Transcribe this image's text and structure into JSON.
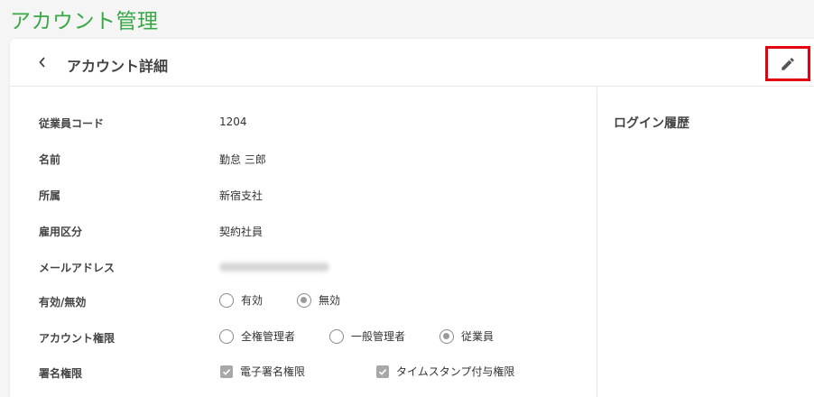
{
  "page_title": "アカウント管理",
  "card": {
    "title": "アカウント詳細",
    "back_icon": "chevron-left-icon",
    "edit_icon": "pencil-icon",
    "highlight_color": "#e3000f",
    "accent_color": "#3aa847"
  },
  "fields": {
    "employee_code": {
      "label": "従業員コード",
      "value": "1204"
    },
    "name": {
      "label": "名前",
      "value": "勤怠 三郎"
    },
    "affiliation": {
      "label": "所属",
      "value": "新宿支社"
    },
    "employment_type": {
      "label": "雇用区分",
      "value": "契約社員"
    },
    "email": {
      "label": "メールアドレス"
    },
    "active": {
      "label": "有効/無効",
      "options": [
        {
          "label": "有効",
          "selected": false
        },
        {
          "label": "無効",
          "selected": true
        }
      ]
    },
    "account_role": {
      "label": "アカウント権限",
      "options": [
        {
          "label": "全権管理者",
          "selected": false
        },
        {
          "label": "一般管理者",
          "selected": false
        },
        {
          "label": "従業員",
          "selected": true
        }
      ]
    },
    "signature_role": {
      "label": "署名権限",
      "options": [
        {
          "label": "電子署名権限",
          "checked": true
        },
        {
          "label": "タイムスタンプ付与権限",
          "checked": true
        }
      ]
    }
  },
  "side": {
    "title": "ログイン履歴"
  }
}
